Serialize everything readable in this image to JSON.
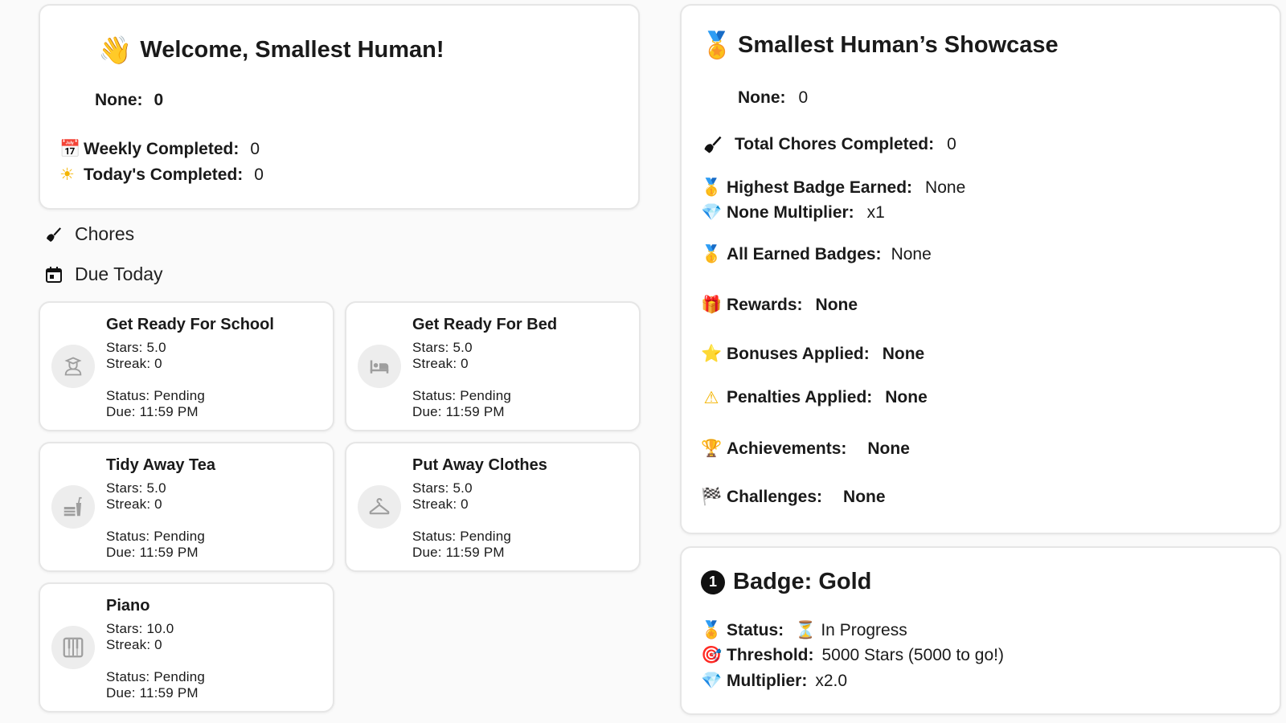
{
  "welcome": {
    "emoji": "👋",
    "title": "Welcome, Smallest Human!",
    "none_label": "None:",
    "none_value": "0",
    "weekly_icon": "📅",
    "weekly_label": "Weekly Completed:",
    "weekly_value": "0",
    "today_icon": "☀",
    "today_label": "Today's Completed:",
    "today_value": "0"
  },
  "sections": {
    "chores": "Chores",
    "due_today": "Due Today"
  },
  "chores": [
    {
      "name": "Get Ready For School",
      "stars": "Stars: 5.0",
      "streak": "Streak: 0",
      "status": "Status: Pending",
      "due": "Due: 11:59 PM",
      "icon": "school-icon"
    },
    {
      "name": "Get Ready For Bed",
      "stars": "Stars: 5.0",
      "streak": "Streak: 0",
      "status": "Status: Pending",
      "due": "Due: 11:59 PM",
      "icon": "bed-icon"
    },
    {
      "name": "Tidy Away Tea",
      "stars": "Stars: 5.0",
      "streak": "Streak: 0",
      "status": "Status: Pending",
      "due": "Due: 11:59 PM",
      "icon": "food-icon"
    },
    {
      "name": "Put Away Clothes",
      "stars": "Stars: 5.0",
      "streak": "Streak: 0",
      "status": "Status: Pending",
      "due": "Due: 11:59 PM",
      "icon": "hanger-icon"
    },
    {
      "name": "Piano",
      "stars": "Stars: 10.0",
      "streak": "Streak: 0",
      "status": "Status: Pending",
      "due": "Due: 11:59 PM",
      "icon": "piano-icon"
    }
  ],
  "showcase": {
    "emoji": "🏅",
    "title": "Smallest Human’s Showcase",
    "none_label": "None:",
    "none_value": "0",
    "total_label": "Total Chores Completed:",
    "total_value": "0",
    "highest_icon": "🥇",
    "highest_label": "Highest Badge Earned:",
    "highest_value": "None",
    "multiplier_icon": "💎",
    "multiplier_label": "None Multiplier:",
    "multiplier_value": "x1",
    "all_badges_icon": "🥇",
    "all_badges_label": "All Earned Badges:",
    "all_badges_value": "None",
    "rewards_icon": "🎁",
    "rewards_label": "Rewards:",
    "rewards_value": "None",
    "bonuses_icon": "⭐",
    "bonuses_label": "Bonuses Applied:",
    "bonuses_value": "None",
    "penalties_icon": "⚠",
    "penalties_label": "Penalties Applied:",
    "penalties_value": "None",
    "achievements_icon": "🏆",
    "achievements_label": "Achievements:",
    "achievements_value": "None",
    "challenges_icon": "🏁",
    "challenges_label": "Challenges:",
    "challenges_value": "None"
  },
  "badge": {
    "number": "1",
    "title": "Badge: Gold",
    "status_icon": "🏅",
    "status_label": "Status:",
    "status_value_icon": "⏳",
    "status_value": "In Progress",
    "threshold_icon": "🎯",
    "threshold_label": "Threshold:",
    "threshold_value": "5000 Stars (5000 to go!)",
    "multiplier_icon": "💎",
    "multiplier_label": "Multiplier:",
    "multiplier_value": "x2.0"
  },
  "colors": {
    "card_border": "#e6e6e6",
    "avatar_bg": "#ededed",
    "icon_gray": "#9e9e9e",
    "text": "#1a1a1a"
  }
}
